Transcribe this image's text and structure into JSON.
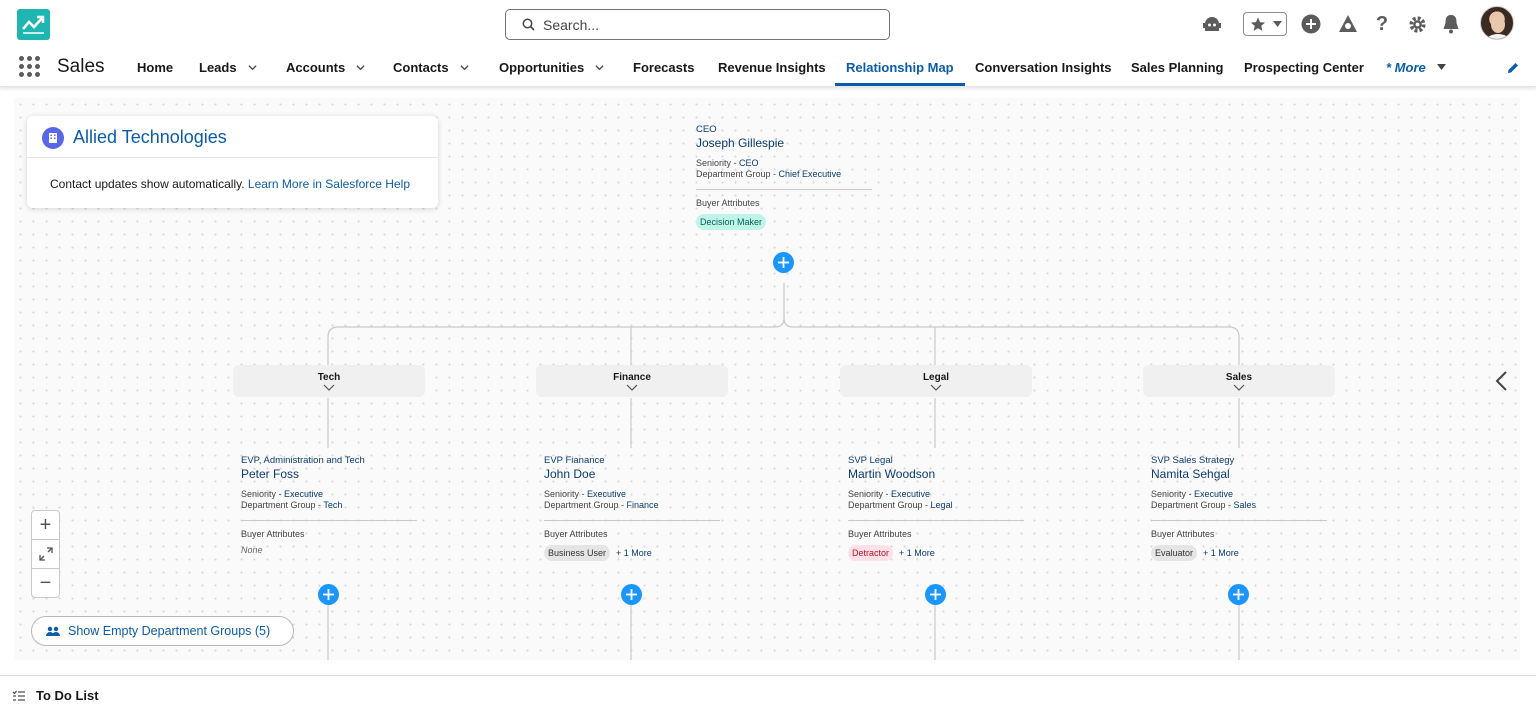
{
  "header": {
    "search_placeholder": "Search...",
    "icons": [
      "app-logo-icon",
      "search-icon",
      "agent-icon",
      "favorites-star-icon",
      "add-icon",
      "trailhead-icon",
      "help-icon",
      "settings-gear-icon",
      "bell-icon",
      "avatar"
    ]
  },
  "nav": {
    "app_name": "Sales",
    "items": [
      {
        "label": "Home"
      },
      {
        "label": "Leads"
      },
      {
        "label": "Accounts"
      },
      {
        "label": "Contacts"
      },
      {
        "label": "Opportunities"
      },
      {
        "label": "Forecasts"
      },
      {
        "label": "Revenue Insights"
      },
      {
        "label": "Relationship Map"
      },
      {
        "label": "Conversation Insights"
      },
      {
        "label": "Sales Planning"
      },
      {
        "label": "Prospecting Center"
      }
    ],
    "more_label": "* More",
    "active": "Relationship Map"
  },
  "account_card": {
    "title": "Allied Technologies",
    "message": "Contact updates show automatically.",
    "link": "Learn More in Salesforce Help"
  },
  "ceo": {
    "role": "CEO",
    "name": "Joseph Gillespie",
    "seniority_label": "Seniority - ",
    "seniority": "CEO",
    "dept_label": "Department Group - ",
    "dept": "Chief Executive",
    "attr_label": "Buyer Attributes",
    "attr": "Decision Maker"
  },
  "departments": [
    "Tech",
    "Finance",
    "Legal",
    "Sales"
  ],
  "people": [
    {
      "role": "EVP, Administration and Tech",
      "name": "Peter Foss",
      "seniority": "Executive",
      "dept": "Tech",
      "attr": "None",
      "more": ""
    },
    {
      "role": "EVP Fianance",
      "name": "John Doe",
      "seniority": "Executive",
      "dept": "Finance",
      "attr": "Business User",
      "more": "+ 1 More"
    },
    {
      "role": "SVP Legal",
      "name": "Martin Woodson",
      "seniority": "Executive",
      "dept": "Legal",
      "attr": "Detractor",
      "more": "+ 1 More"
    },
    {
      "role": "SVP Sales Strategy",
      "name": "Namita Sehgal",
      "seniority": "Executive",
      "dept": "Sales",
      "attr": "Evaluator",
      "more": "+ 1 More"
    }
  ],
  "labels": {
    "seniority": "Seniority - ",
    "dept": "Department Group - ",
    "attrs": "Buyer Attributes"
  },
  "controls": {
    "show_empty": "Show Empty Department Groups (5)",
    "zoom_in": "+",
    "zoom_out": "−"
  },
  "footer": {
    "todo": "To Do List"
  },
  "colors": {
    "brand": "#0b5cab",
    "add_button": "#1b96ff",
    "decision_maker": "#bff5e8",
    "detractor": "#fde1e6"
  }
}
